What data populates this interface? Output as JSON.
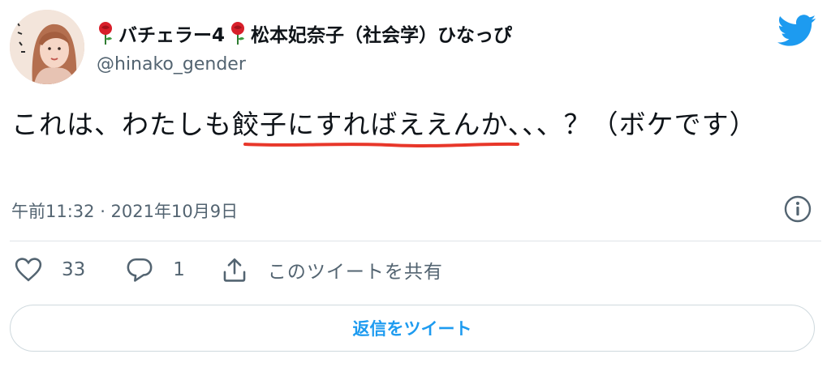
{
  "author": {
    "name_prefix": "バチェラー4",
    "name_main": "松本妃奈子（社会学）ひなっぴ",
    "handle": "@hinako_gender"
  },
  "tweet": {
    "text": "これは、わたしも餃子にすればええんか、、、？（ボケです）",
    "timestamp": "午前11:32 · 2021年10月9日"
  },
  "stats": {
    "likes": "33",
    "replies": "1",
    "share_label": "このツイートを共有"
  },
  "reply_button_label": "返信をツイート",
  "icons": {
    "brand": "twitter-bird-icon",
    "info": "info-icon",
    "like": "heart-icon",
    "reply": "speech-bubble-icon",
    "share": "share-icon",
    "emoji": "rose-icon"
  },
  "colors": {
    "twitter_blue": "#1d9bf0",
    "text_primary": "#0f1419",
    "text_secondary": "#536471",
    "border": "#cfd9de",
    "underline_mark": "#e8372a"
  }
}
